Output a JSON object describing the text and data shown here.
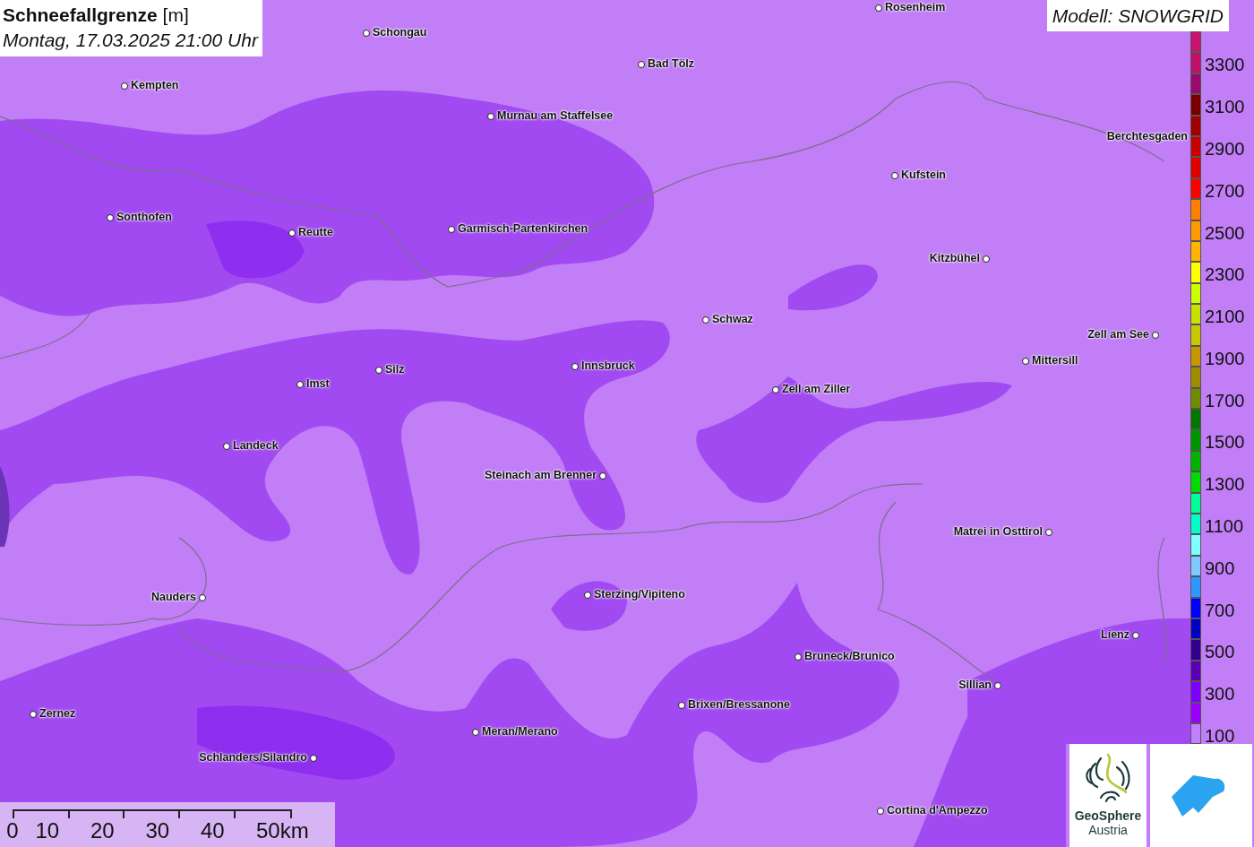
{
  "title": {
    "name": "Schneefallgrenze",
    "unit": "[m]",
    "datetime": "Montag, 17.03.2025 21:00 Uhr"
  },
  "model_label": "Modell: SNOWGRID",
  "cities": [
    {
      "name": "Rosenheim"
    },
    {
      "name": "Schongau"
    },
    {
      "name": "Bad Tölz"
    },
    {
      "name": "Kempten"
    },
    {
      "name": "Murnau am Staffelsee"
    },
    {
      "name": "Berchtesgaden"
    },
    {
      "name": "Kufstein"
    },
    {
      "name": "Sonthofen"
    },
    {
      "name": "Garmisch-Partenkirchen"
    },
    {
      "name": "Reutte"
    },
    {
      "name": "Kitzbühel"
    },
    {
      "name": "Schwaz"
    },
    {
      "name": "Zell am See"
    },
    {
      "name": "Mittersill"
    },
    {
      "name": "Innsbruck"
    },
    {
      "name": "Silz"
    },
    {
      "name": "Imst"
    },
    {
      "name": "Zell am Ziller"
    },
    {
      "name": "Landeck"
    },
    {
      "name": "Steinach am Brenner"
    },
    {
      "name": "Matrei in Osttirol"
    },
    {
      "name": "Nauders"
    },
    {
      "name": "Sterzing/Vipiteno"
    },
    {
      "name": "Lienz"
    },
    {
      "name": "Bruneck/Brunico"
    },
    {
      "name": "Sillian"
    },
    {
      "name": "Brixen/Bressanone"
    },
    {
      "name": "Zernez"
    },
    {
      "name": "Meran/Merano"
    },
    {
      "name": "Schlanders/Silandro"
    },
    {
      "name": "Cortina d'Ampezzo"
    }
  ],
  "legend": [
    {
      "color": "#c8146e"
    },
    {
      "label": "3300",
      "color": "#c0106a"
    },
    {
      "color": "#9a0a6e"
    },
    {
      "label": "3100",
      "color": "#7a0000"
    },
    {
      "color": "#a00000"
    },
    {
      "label": "2900",
      "color": "#c80000"
    },
    {
      "color": "#e00000"
    },
    {
      "label": "2700",
      "color": "#ff0000"
    },
    {
      "color": "#ff8000"
    },
    {
      "label": "2500",
      "color": "#ff9a00"
    },
    {
      "color": "#ffb400"
    },
    {
      "label": "2300",
      "color": "#ffff00"
    },
    {
      "color": "#ccff00"
    },
    {
      "label": "2100",
      "color": "#c8e000"
    },
    {
      "color": "#c8c800"
    },
    {
      "label": "1900",
      "color": "#c89600"
    },
    {
      "color": "#a08c00"
    },
    {
      "label": "1700",
      "color": "#6e8c00"
    },
    {
      "color": "#007800"
    },
    {
      "label": "1500",
      "color": "#009600"
    },
    {
      "color": "#00b400"
    },
    {
      "label": "1300",
      "color": "#00dc00"
    },
    {
      "color": "#00ff96"
    },
    {
      "label": "1100",
      "color": "#00ffc8"
    },
    {
      "color": "#80ffff"
    },
    {
      "label": "900",
      "color": "#80c8ff"
    },
    {
      "color": "#3296ff"
    },
    {
      "label": "700",
      "color": "#0000ff"
    },
    {
      "color": "#0000c0"
    },
    {
      "label": "500",
      "color": "#32008c"
    },
    {
      "color": "#5a00b4"
    },
    {
      "label": "300",
      "color": "#7d00ff"
    },
    {
      "color": "#9b00ff"
    },
    {
      "label": "100",
      "color": "#c080ff"
    }
  ],
  "scale_bar": {
    "ticks": [
      "0",
      "10",
      "20",
      "30",
      "40",
      "50km"
    ]
  },
  "logos": {
    "geosphere": [
      "GeoSphere",
      "Austria"
    ]
  }
}
